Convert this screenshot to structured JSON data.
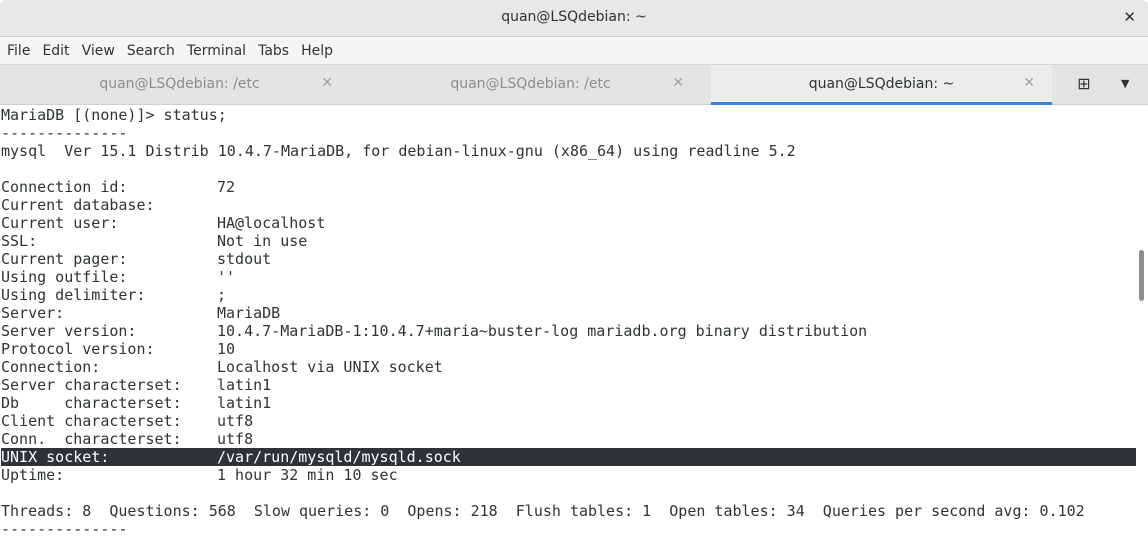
{
  "window": {
    "title": "quan@LSQdebian: ~"
  },
  "menu": [
    "File",
    "Edit",
    "View",
    "Search",
    "Terminal",
    "Tabs",
    "Help"
  ],
  "tabs": [
    {
      "label": "quan@LSQdebian: /etc"
    },
    {
      "label": "quan@LSQdebian: /etc"
    },
    {
      "label": "quan@LSQdebian: ~"
    }
  ],
  "terminal": {
    "lines": [
      {
        "a": "MariaDB [(none)]> status;",
        "b": ""
      },
      {
        "a": "--------------",
        "b": ""
      },
      {
        "a": "mysql  Ver 15.1 Distrib 10.4.7-MariaDB, for debian-linux-gnu (x86_64) using readline 5.2",
        "b": ""
      },
      {
        "a": "",
        "b": ""
      },
      {
        "a": "Connection id:",
        "b": "72"
      },
      {
        "a": "Current database:",
        "b": ""
      },
      {
        "a": "Current user:",
        "b": "HA@localhost"
      },
      {
        "a": "SSL:",
        "b": "Not in use"
      },
      {
        "a": "Current pager:",
        "b": "stdout"
      },
      {
        "a": "Using outfile:",
        "b": "''"
      },
      {
        "a": "Using delimiter:",
        "b": ";"
      },
      {
        "a": "Server:",
        "b": "MariaDB"
      },
      {
        "a": "Server version:",
        "b": "10.4.7-MariaDB-1:10.4.7+maria~buster-log mariadb.org binary distribution"
      },
      {
        "a": "Protocol version:",
        "b": "10"
      },
      {
        "a": "Connection:",
        "b": "Localhost via UNIX socket"
      },
      {
        "a": "Server characterset:",
        "b": "latin1"
      },
      {
        "a": "Db     characterset:",
        "b": "latin1"
      },
      {
        "a": "Client characterset:",
        "b": "utf8"
      },
      {
        "a": "Conn.  characterset:",
        "b": "utf8"
      },
      {
        "a": "UNIX socket:",
        "b": "/var/run/mysqld/mysqld.sock"
      },
      {
        "a": "Uptime:",
        "b": "1 hour 32 min 10 sec"
      },
      {
        "a": "",
        "b": ""
      },
      {
        "a": "Threads: 8  Questions: 568  Slow queries: 0  Opens: 218  Flush tables: 1  Open tables: 34  Queries per second avg: 0.102",
        "b": ""
      },
      {
        "a": "--------------",
        "b": ""
      }
    ]
  }
}
